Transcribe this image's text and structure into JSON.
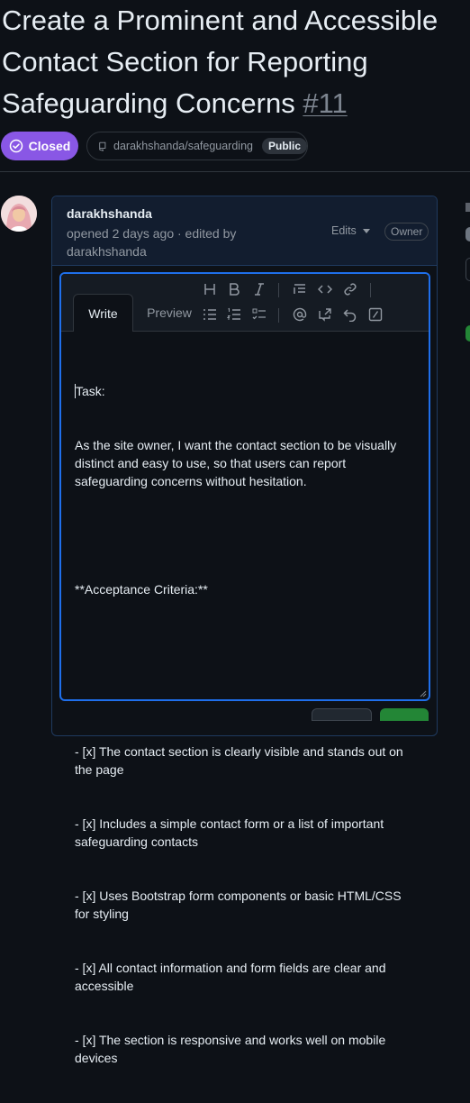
{
  "issue": {
    "title": "Create a Prominent and Accessible Contact Section for Reporting Safeguarding Concerns",
    "number": "#11",
    "status": "Closed",
    "repo": "darakhshanda/safeguarding",
    "visibility": "Public"
  },
  "comment": {
    "author": "darakhshanda",
    "meta": "opened 2 days ago · edited by darakhshanda",
    "edits_label": "Edits",
    "role_badge": "Owner"
  },
  "editor": {
    "tabs": [
      "Write",
      "Preview"
    ],
    "toolbar_icons": [
      "heading-icon",
      "bold-icon",
      "italic-icon",
      "quote-icon",
      "code-icon",
      "link-icon",
      "unordered-list-icon",
      "ordered-list-icon",
      "task-list-icon",
      "mention-icon",
      "cross-reference-icon",
      "undo-icon",
      "slash-command-icon"
    ],
    "body_lines": [
      "Task:",
      "As the site owner, I want the contact section to be visually distinct and easy to use, so that users can report safeguarding concerns without hesitation.",
      "",
      "**Acceptance Criteria:**",
      "",
      "",
      "- [x] The contact section is clearly visible and stands out on the page",
      "- [x] Includes a simple contact form or a list of important safeguarding contacts",
      "- [x] Uses Bootstrap form components or basic HTML/CSS for styling",
      "- [x] All contact information and form fields are clear and accessible",
      "- [x] The section is responsive and works well on mobile devices"
    ]
  },
  "colors": {
    "closed": "#8957e5",
    "focus": "#1f6feb",
    "background": "#0d1117"
  }
}
